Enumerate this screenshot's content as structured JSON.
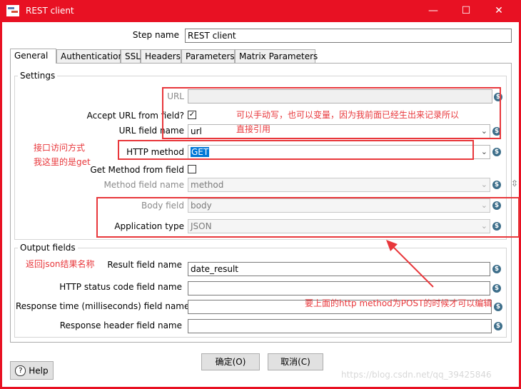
{
  "window": {
    "title": "REST client",
    "minimize": "—",
    "maximize": "☐",
    "close": "✕"
  },
  "step": {
    "label": "Step name",
    "value": "REST client"
  },
  "tabs": [
    "General",
    "Authentication",
    "SSL",
    "Headers",
    "Parameters",
    "Matrix Parameters"
  ],
  "settings": {
    "group_title": "Settings",
    "url_label": "URL",
    "url_value": "",
    "accept_url_label": "Accept URL from field?",
    "accept_url_checked": "✓",
    "url_field_label": "URL field name",
    "url_field_value": "url",
    "http_method_label": "HTTP method",
    "http_method_value": "GET",
    "get_method_label": "Get Method from field",
    "method_field_label": "Method field name",
    "method_field_value": "method",
    "body_field_label": "Body field",
    "body_field_value": "body",
    "app_type_label": "Application type",
    "app_type_value": "JSON"
  },
  "output": {
    "group_title": "Output fields",
    "result_label": "Result field name",
    "result_value": "date_result",
    "status_label": "HTTP status code field name",
    "status_value": "",
    "response_time_label": "Response time (milliseconds) field name",
    "response_time_value": "",
    "response_header_label": "Response header field name",
    "response_header_value": ""
  },
  "annotations": {
    "url_note_line1": "可以手动写，也可以变量，因为我前面已经生出来记录所以",
    "url_note_line2": "直接引用",
    "method_note_line1": "接口访问方式",
    "method_note_line2": "我这里的是get",
    "json_note": "返回json结果名称",
    "post_note": "要上面的http method为POST的时候才可以编辑"
  },
  "buttons": {
    "ok": "确定(O)",
    "cancel": "取消(C)",
    "help": "Help"
  },
  "watermark": "https://blog.csdn.net/qq_39425846",
  "icons": {
    "variable": "$",
    "dropdown": "⌄",
    "help": "?"
  },
  "colors": {
    "titlebar": "#e81123",
    "annotation": "#e8373b",
    "selection": "#0078d7"
  }
}
